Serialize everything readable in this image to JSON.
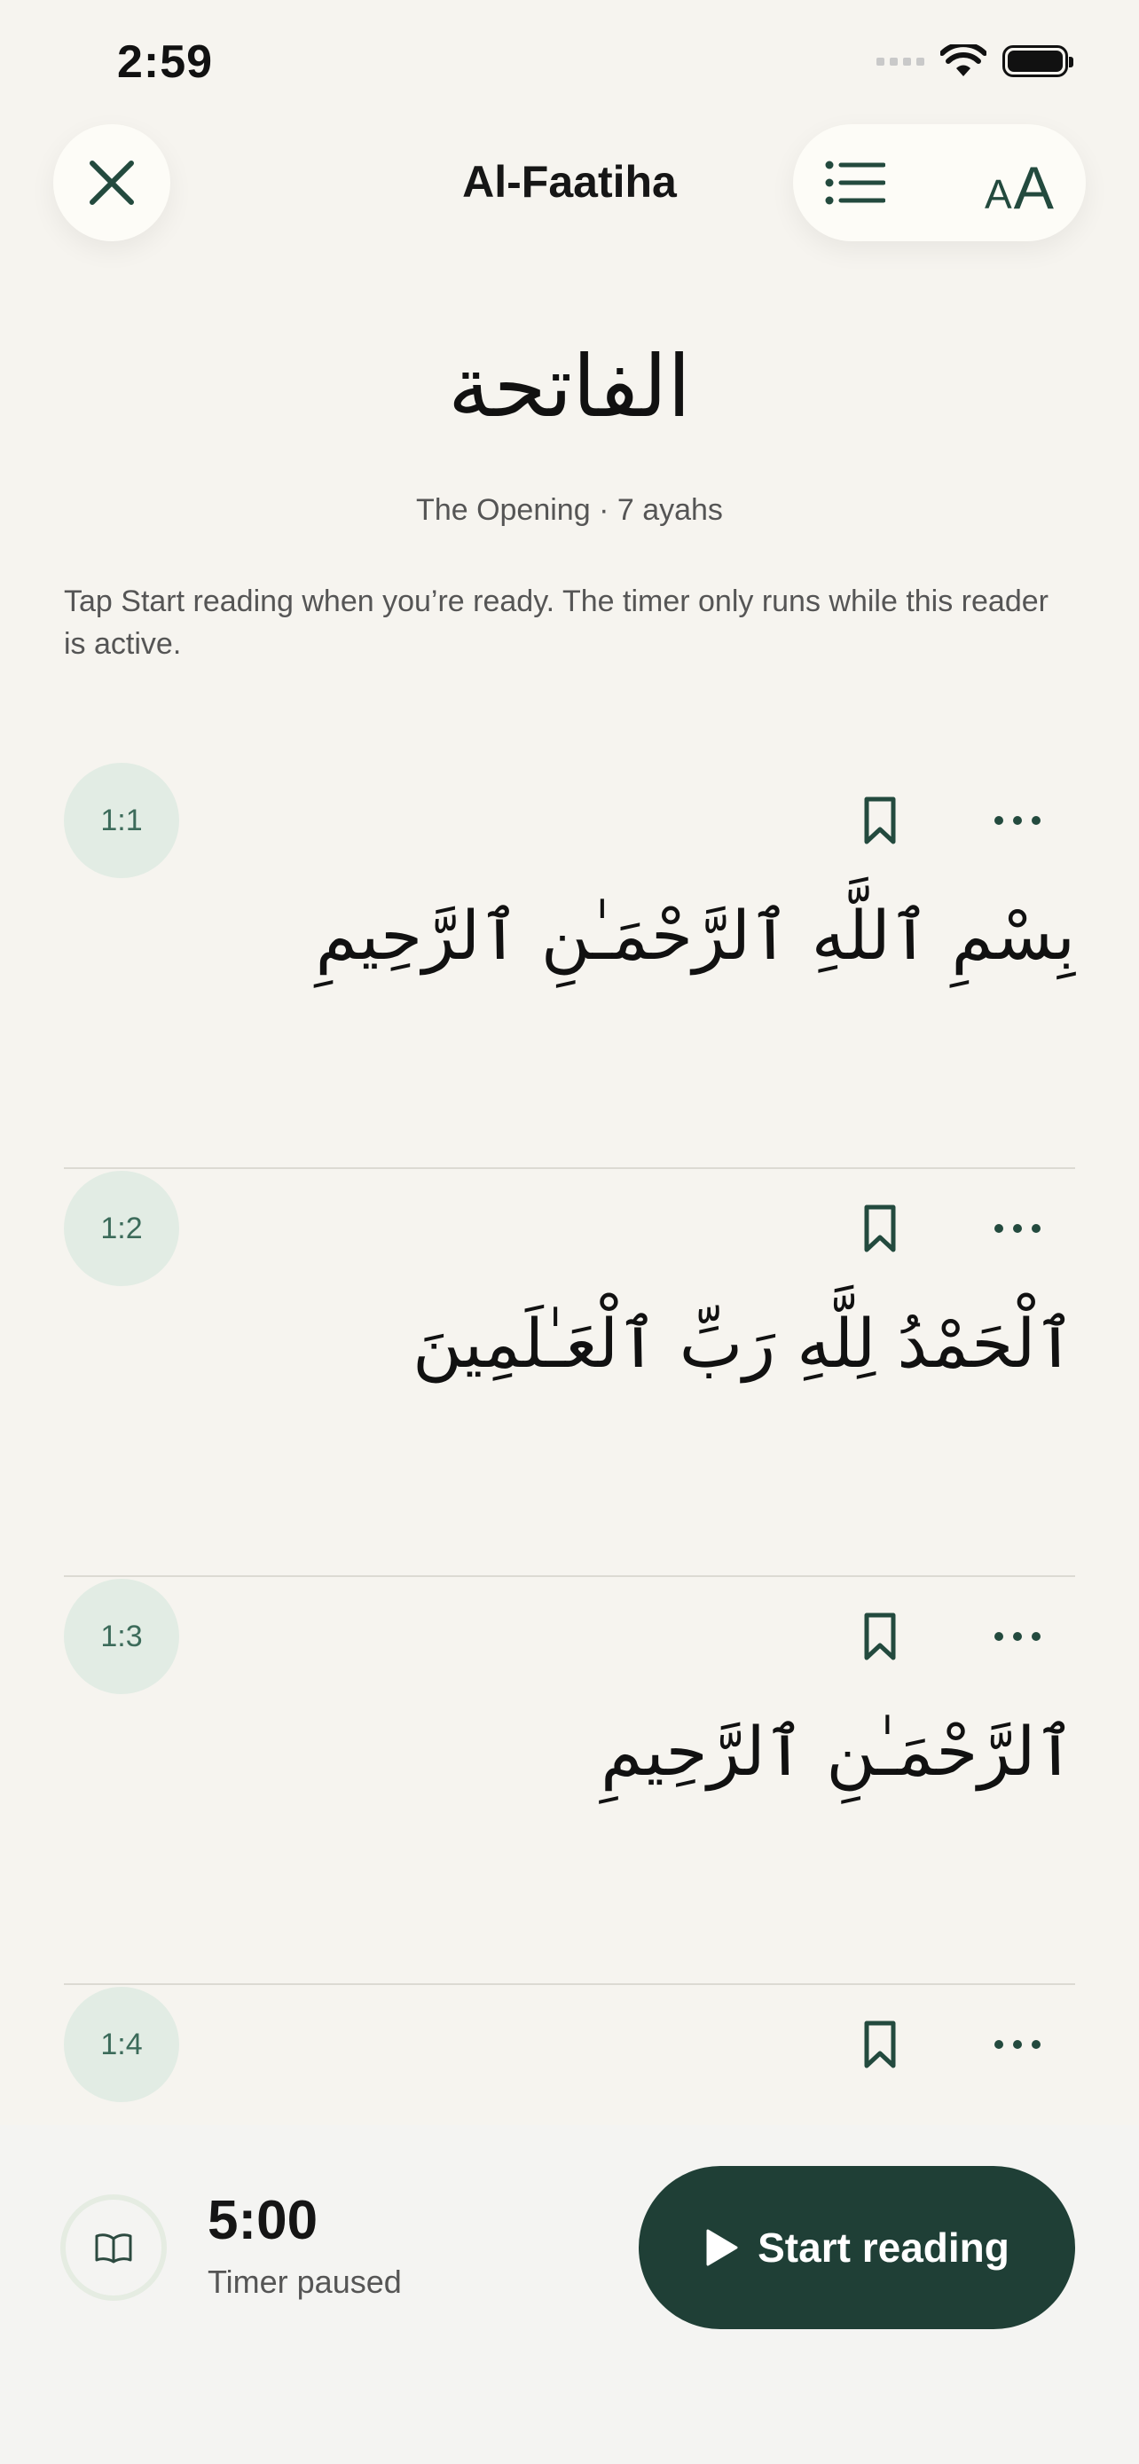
{
  "status_bar": {
    "time": "2:59",
    "icons": [
      "cellular-icon",
      "wifi-icon",
      "battery-icon"
    ]
  },
  "header": {
    "title": "Al-Faatiha",
    "close_icon": "close-icon",
    "list_icon": "list-icon",
    "font_size_small": "A",
    "font_size_large": "A"
  },
  "surah": {
    "arabic_name": "الفاتحة",
    "subtitle": "The Opening · 7 ayahs",
    "instructions": "Tap Start reading when you’re ready. The timer only runs while this reader is active."
  },
  "ayahs": [
    {
      "number": "1:1",
      "text": "بِسْمِ ٱللَّهِ ٱلرَّحْمَـٰنِ ٱلرَّحِيمِ"
    },
    {
      "number": "1:2",
      "text": "ٱلْحَمْدُ لِلَّهِ رَبِّ ٱلْعَـٰلَمِينَ"
    },
    {
      "number": "1:3",
      "text": "ٱلرَّحْمَـٰنِ ٱلرَّحِيمِ"
    },
    {
      "number": "1:4",
      "text": ""
    }
  ],
  "timer": {
    "value": "5:00",
    "status": "Timer paused",
    "icon": "book-icon"
  },
  "actions": {
    "start_label": "Start reading",
    "start_icon": "play-icon"
  },
  "colors": {
    "background": "#f6f4ef",
    "accent": "#1f3f36",
    "icon": "#234a3e",
    "ayah_badge": "#e2ece4"
  }
}
